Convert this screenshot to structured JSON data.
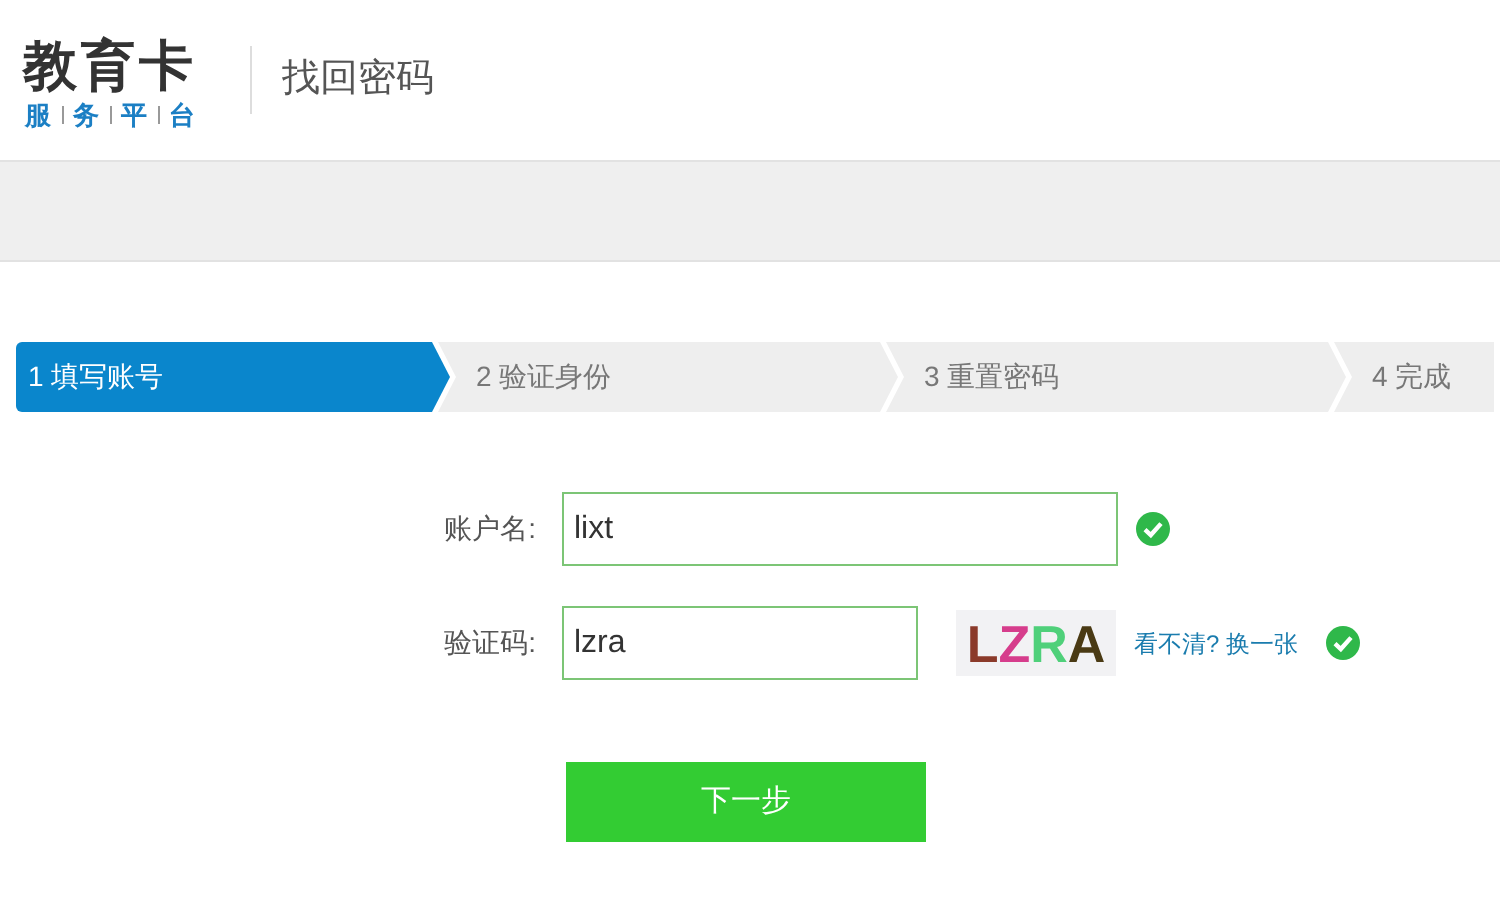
{
  "logo": {
    "title": "教育卡",
    "subtitle": [
      "服",
      "务",
      "平",
      "台"
    ]
  },
  "page_title": "找回密码",
  "steps": [
    {
      "label": "1 填写账号",
      "selected": true
    },
    {
      "label": "2 验证身份",
      "selected": false
    },
    {
      "label": "3 重置密码",
      "selected": false
    },
    {
      "label": "4 完成",
      "selected": false
    }
  ],
  "form": {
    "account": {
      "label": "账户名:",
      "value": "lixt",
      "valid": true
    },
    "captcha": {
      "label": "验证码:",
      "value": "lzra",
      "valid": true,
      "letters": [
        {
          "char": "L",
          "color": "#8b3a2a"
        },
        {
          "char": "Z",
          "color": "#d63d8c"
        },
        {
          "char": "R",
          "color": "#4fd07a"
        },
        {
          "char": "A",
          "color": "#4a3a14"
        }
      ],
      "refresh_link": "看不清? 换一张"
    },
    "submit": "下一步"
  }
}
